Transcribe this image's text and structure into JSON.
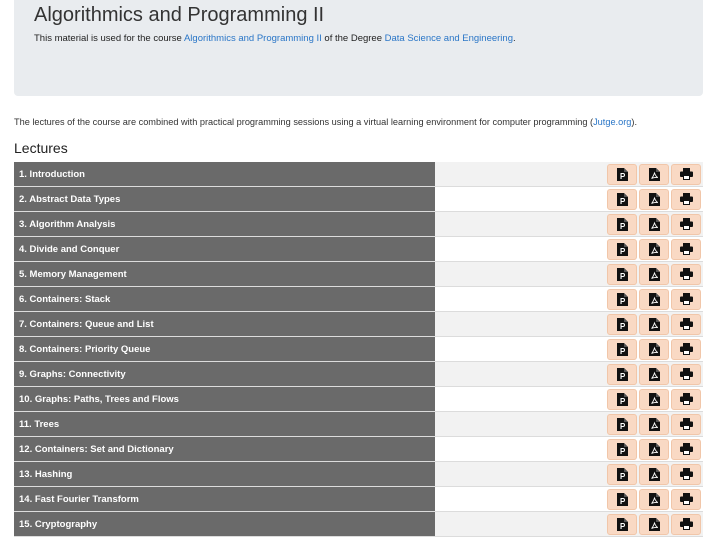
{
  "header": {
    "title": "Algorithmics and Programming II",
    "lead_prefix": "This material is used for the course ",
    "course_link": "Algorithmics and Programming II",
    "lead_middle": " of the Degree ",
    "degree_link": "Data Science and Engineering",
    "lead_suffix": "."
  },
  "intro": {
    "text": "The lectures of the course are combined with practical programming sessions using a virtual learning environment for computer programming (",
    "link": "Jutge.org",
    "suffix": ")."
  },
  "lectures": {
    "heading": "Lectures",
    "items": [
      {
        "label": "1. Introduction"
      },
      {
        "label": "2. Abstract Data Types"
      },
      {
        "label": "3. Algorithm Analysis"
      },
      {
        "label": "4. Divide and Conquer"
      },
      {
        "label": "5. Memory Management"
      },
      {
        "label": "6. Containers: Stack"
      },
      {
        "label": "7. Containers: Queue and List"
      },
      {
        "label": "8. Containers: Priority Queue"
      },
      {
        "label": "9. Graphs: Connectivity"
      },
      {
        "label": "10. Graphs: Paths, Trees and Flows"
      },
      {
        "label": "11. Trees"
      },
      {
        "label": "12. Containers: Set and Dictionary"
      },
      {
        "label": "13. Hashing"
      },
      {
        "label": "14. Fast Fourier Transform"
      },
      {
        "label": "15. Cryptography"
      }
    ]
  },
  "icons": {
    "slides": "powerpoint-file-icon",
    "pdf": "pdf-file-icon",
    "print": "print-icon"
  },
  "colors": {
    "row_header_bg": "#6a6a6a",
    "button_bg": "#f9d9c4",
    "link": "#2a76c7",
    "jumbotron_bg": "#e9ecef"
  }
}
